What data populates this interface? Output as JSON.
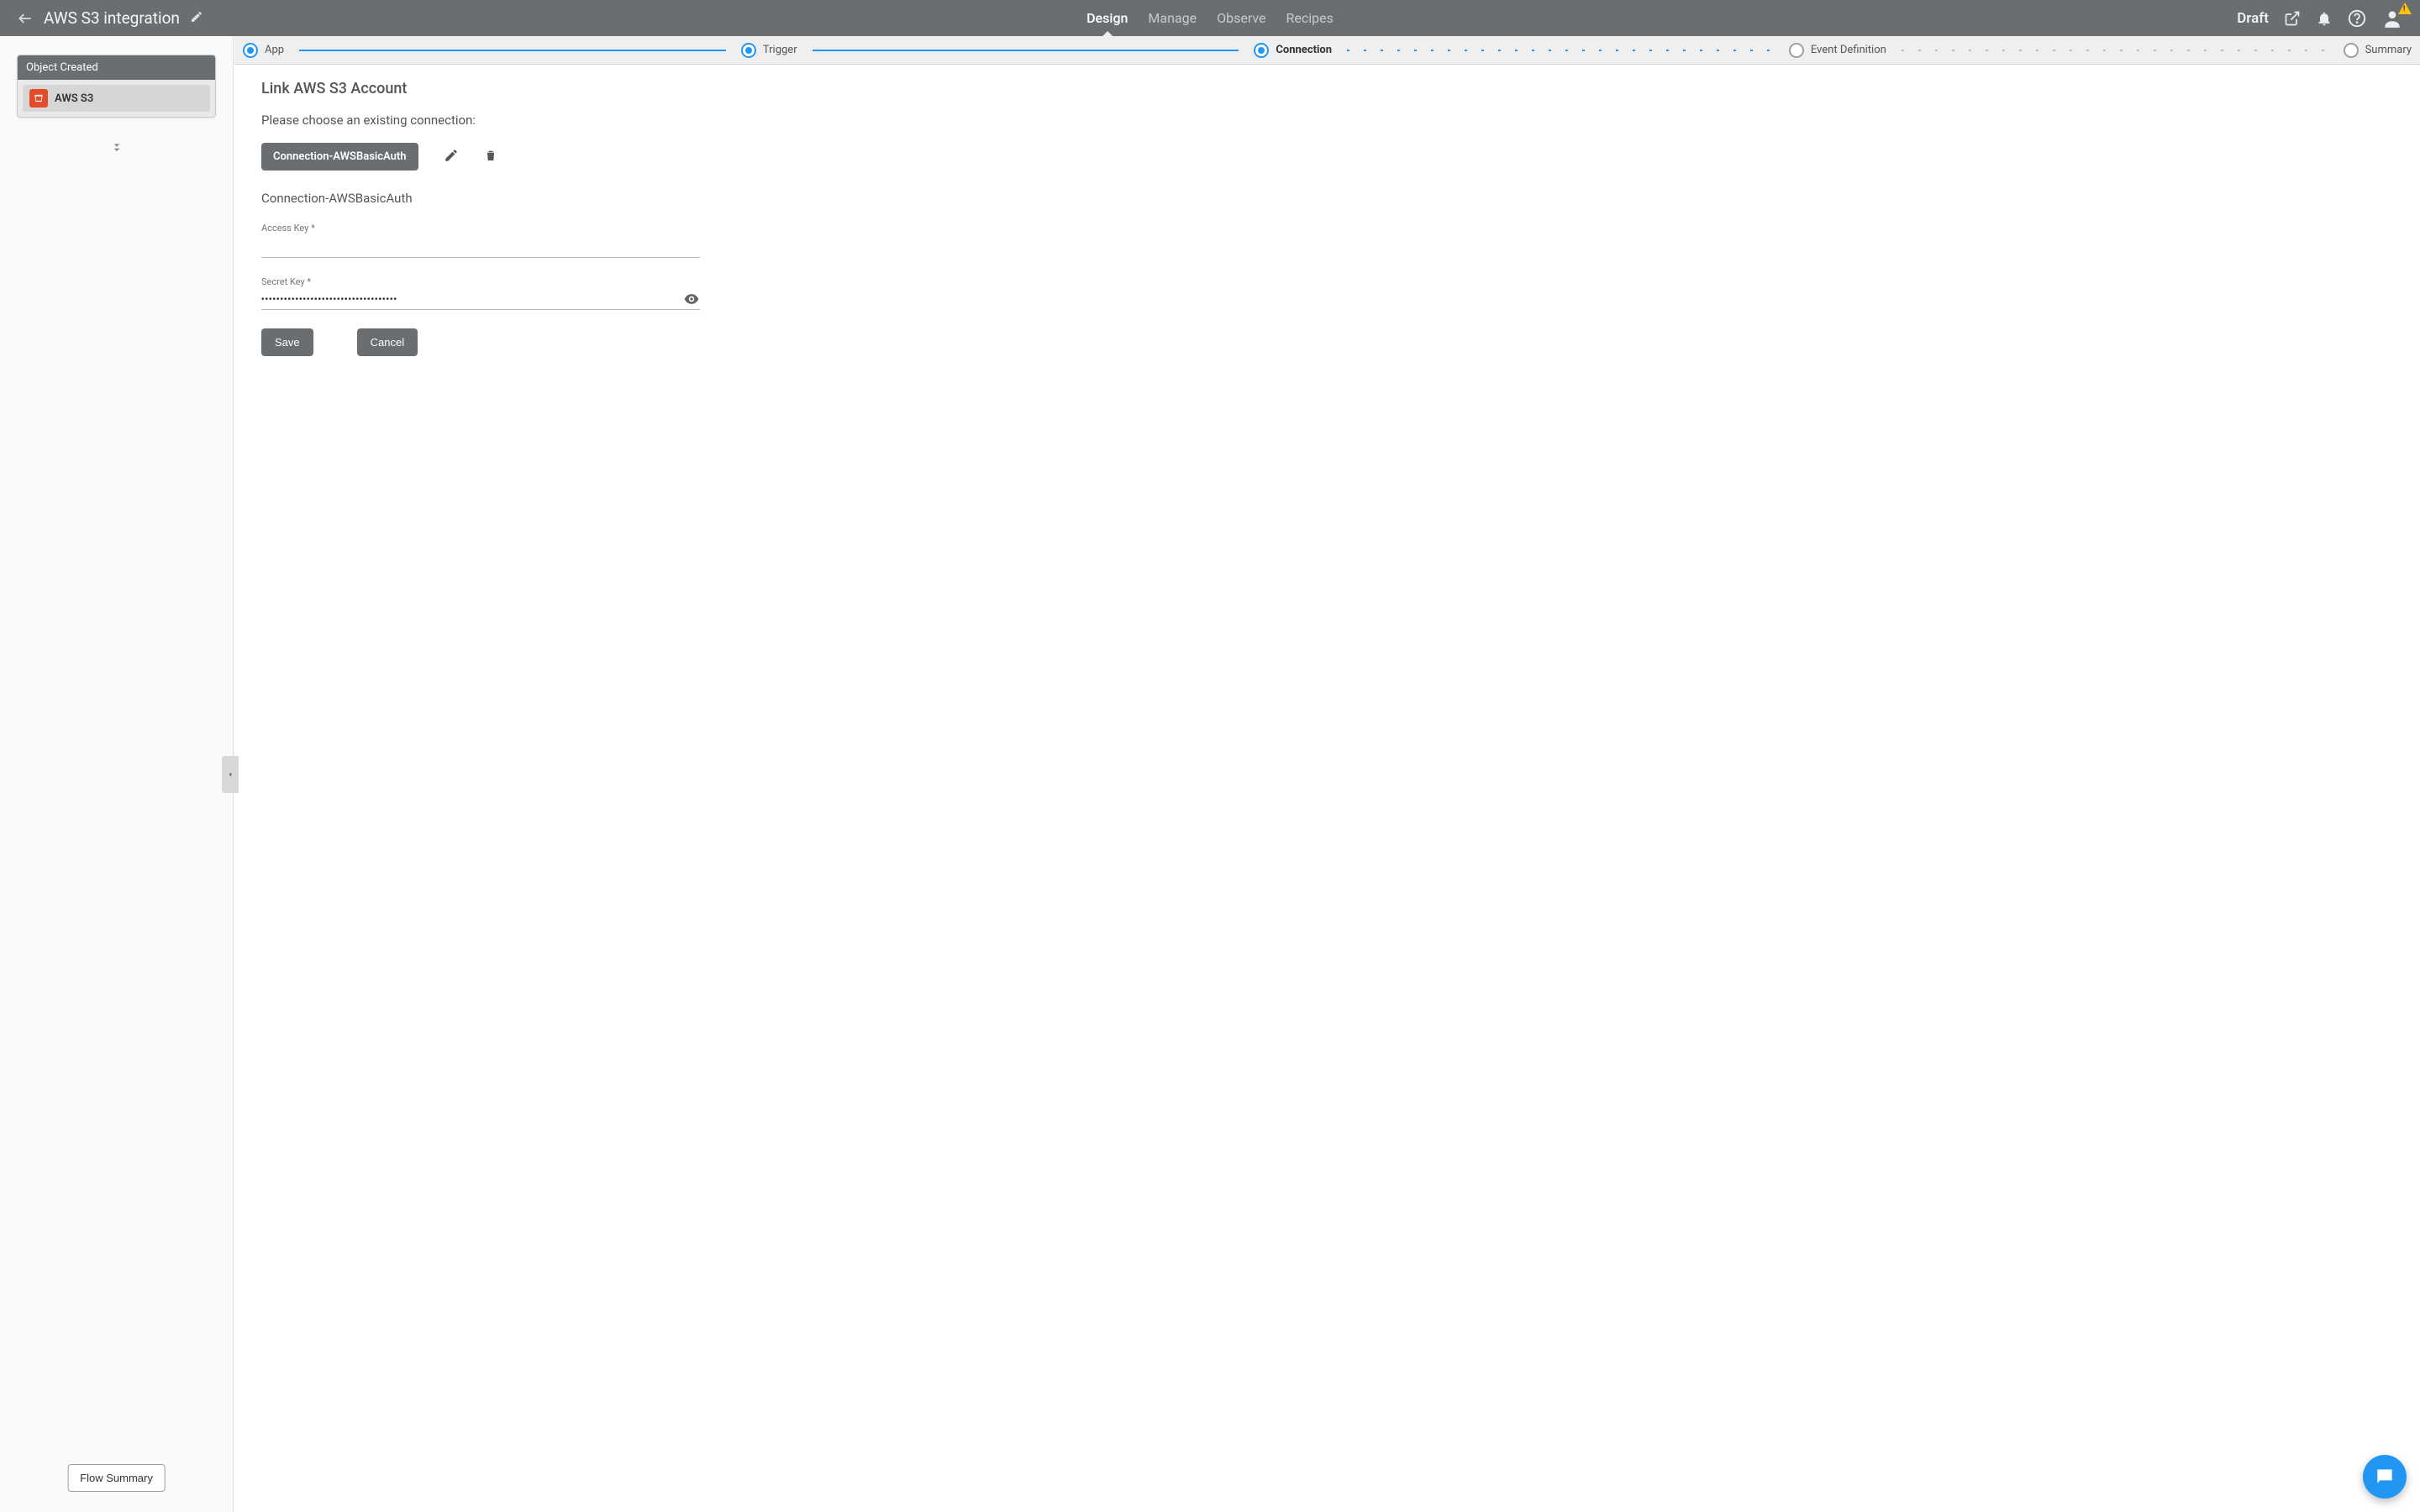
{
  "header": {
    "title": "AWS S3 integration",
    "status": "Draft",
    "tabs": [
      {
        "label": "Design",
        "active": true
      },
      {
        "label": "Manage",
        "active": false
      },
      {
        "label": "Observe",
        "active": false
      },
      {
        "label": "Recipes",
        "active": false
      }
    ]
  },
  "stepper": [
    {
      "label": "App",
      "state": "done"
    },
    {
      "label": "Trigger",
      "state": "done"
    },
    {
      "label": "Connection",
      "state": "current"
    },
    {
      "label": "Event Definition",
      "state": "pending"
    },
    {
      "label": "Summary",
      "state": "pending"
    }
  ],
  "sidebar": {
    "card_title": "Object Created",
    "app_name": "AWS S3",
    "flow_summary_label": "Flow Summary"
  },
  "content": {
    "heading": "Link AWS S3 Account",
    "prompt": "Please choose an existing connection:",
    "connection_chip": "Connection-AWSBasicAuth",
    "connection_name": "Connection-AWSBasicAuth",
    "fields": {
      "access_key": {
        "label": "Access Key *",
        "value": ""
      },
      "secret_key": {
        "label": "Secret Key *",
        "value": "••••••••••••••••••••••••••••••••••••"
      }
    },
    "buttons": {
      "save": "Save",
      "cancel": "Cancel"
    }
  },
  "colors": {
    "accent": "#2196f3",
    "header_bg": "#6b6e70"
  }
}
